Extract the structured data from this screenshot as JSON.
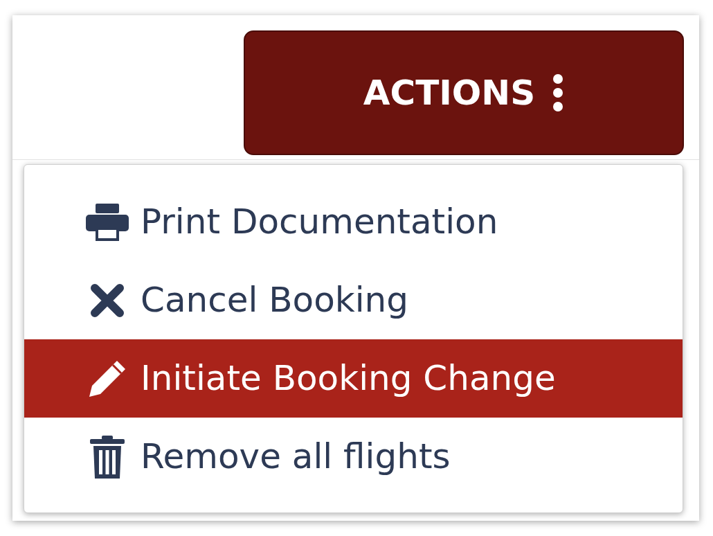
{
  "actions_button": {
    "label": "ACTIONS"
  },
  "menu": {
    "items": [
      {
        "kind": "print",
        "label": "Print Documentation",
        "selected": false
      },
      {
        "kind": "cancel",
        "label": "Cancel Booking",
        "selected": false
      },
      {
        "kind": "edit",
        "label": "Initiate Booking Change",
        "selected": true
      },
      {
        "kind": "trash",
        "label": "Remove all flights",
        "selected": false
      }
    ]
  }
}
